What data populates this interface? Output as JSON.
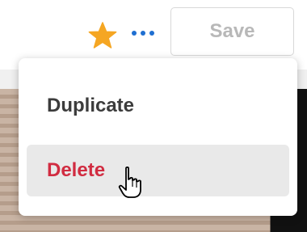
{
  "toolbar": {
    "save_label": "Save",
    "star_icon": "star-icon",
    "more_icon": "more-dots-icon",
    "star_color": "#f5a623",
    "more_color": "#1f6fd1"
  },
  "menu": {
    "items": [
      {
        "label": "Duplicate",
        "color": "#3c3c3c"
      },
      {
        "label": "Delete",
        "color": "#d12c41",
        "highlighted": true
      }
    ]
  },
  "cursor": {
    "icon": "hand-pointer-icon"
  }
}
